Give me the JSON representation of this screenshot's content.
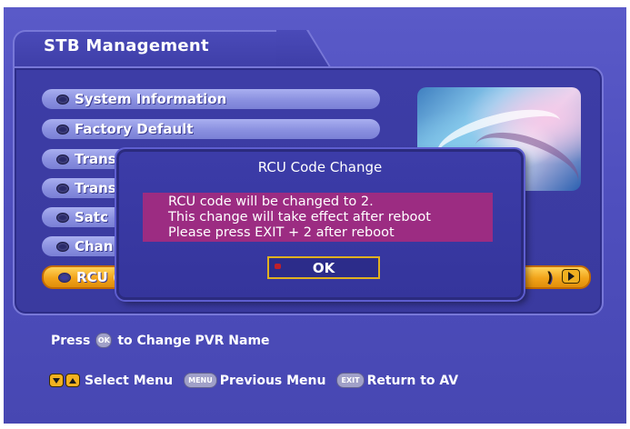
{
  "header": {
    "title": "STB Management"
  },
  "menu": {
    "items": [
      {
        "label": "System Information"
      },
      {
        "label": "Factory Default"
      },
      {
        "label": "Trans"
      },
      {
        "label": "Trans"
      },
      {
        "label": "Satc"
      },
      {
        "label": "Chan"
      },
      {
        "label": "RCU ("
      }
    ],
    "selected_suffix": ")"
  },
  "dialog": {
    "title": "RCU Code Change",
    "lines": [
      "RCU code will be changed to 2.",
      "This change will take effect after reboot",
      "Please press EXIT + 2 after reboot"
    ],
    "ok_label": "OK"
  },
  "help": {
    "press_label": "Press",
    "ok_key": "OK",
    "change_label": "to Change PVR Name",
    "select_label": "Select Menu",
    "menu_key": "MENU",
    "previous_label": "Previous Menu",
    "exit_key": "EXIT",
    "return_label": "Return to AV"
  },
  "colors": {
    "background": "#4f4fbe",
    "panel": "#3d3da6",
    "menu_item": "#8a90e0",
    "selected_item": "#f2a41a",
    "dialog_message": "#9c2c82",
    "ok_border": "#e0b020"
  }
}
